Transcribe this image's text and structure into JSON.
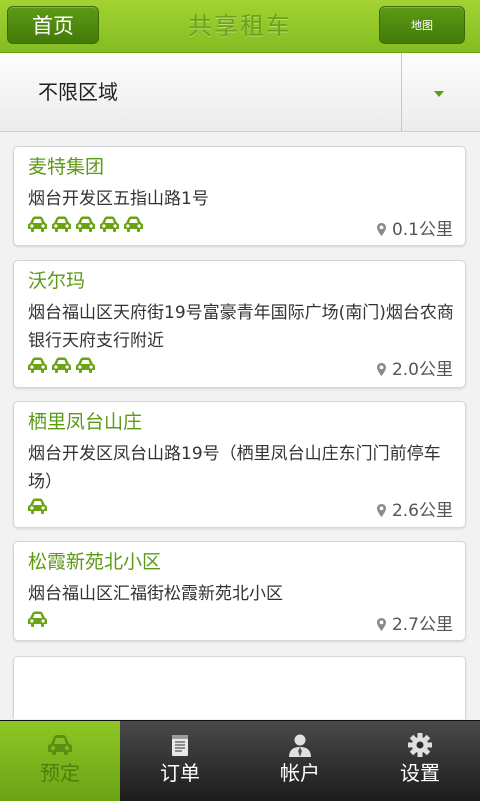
{
  "header": {
    "home_label": "首页",
    "title": "共享租车",
    "map_label": "地图"
  },
  "filter": {
    "selected": "不限区域"
  },
  "stations": [
    {
      "name": "麦特集团",
      "address": "烟台开发区五指山路1号",
      "cars": 5,
      "distance": "0.1公里"
    },
    {
      "name": "沃尔玛",
      "address": "烟台福山区天府街19号富豪青年国际广场(南门)烟台农商银行天府支行附近",
      "cars": 3,
      "distance": "2.0公里"
    },
    {
      "name": "栖里凤台山庄",
      "address": "烟台开发区凤台山路19号（栖里凤台山庄东门门前停车场）",
      "cars": 1,
      "distance": "2.6公里"
    },
    {
      "name": "松霞新苑北小区",
      "address": "烟台福山区汇福街松霞新苑北小区",
      "cars": 1,
      "distance": "2.7公里"
    }
  ],
  "tabs": [
    {
      "label": "预定",
      "icon": "car-icon",
      "active": true
    },
    {
      "label": "订单",
      "icon": "notepad-icon",
      "active": false
    },
    {
      "label": "帐户",
      "icon": "user-icon",
      "active": false
    },
    {
      "label": "设置",
      "icon": "gear-icon",
      "active": false
    }
  ],
  "colors": {
    "accent": "#6aa314",
    "text_green": "#5d9a16",
    "tab_bar": "#2a2a2a"
  }
}
